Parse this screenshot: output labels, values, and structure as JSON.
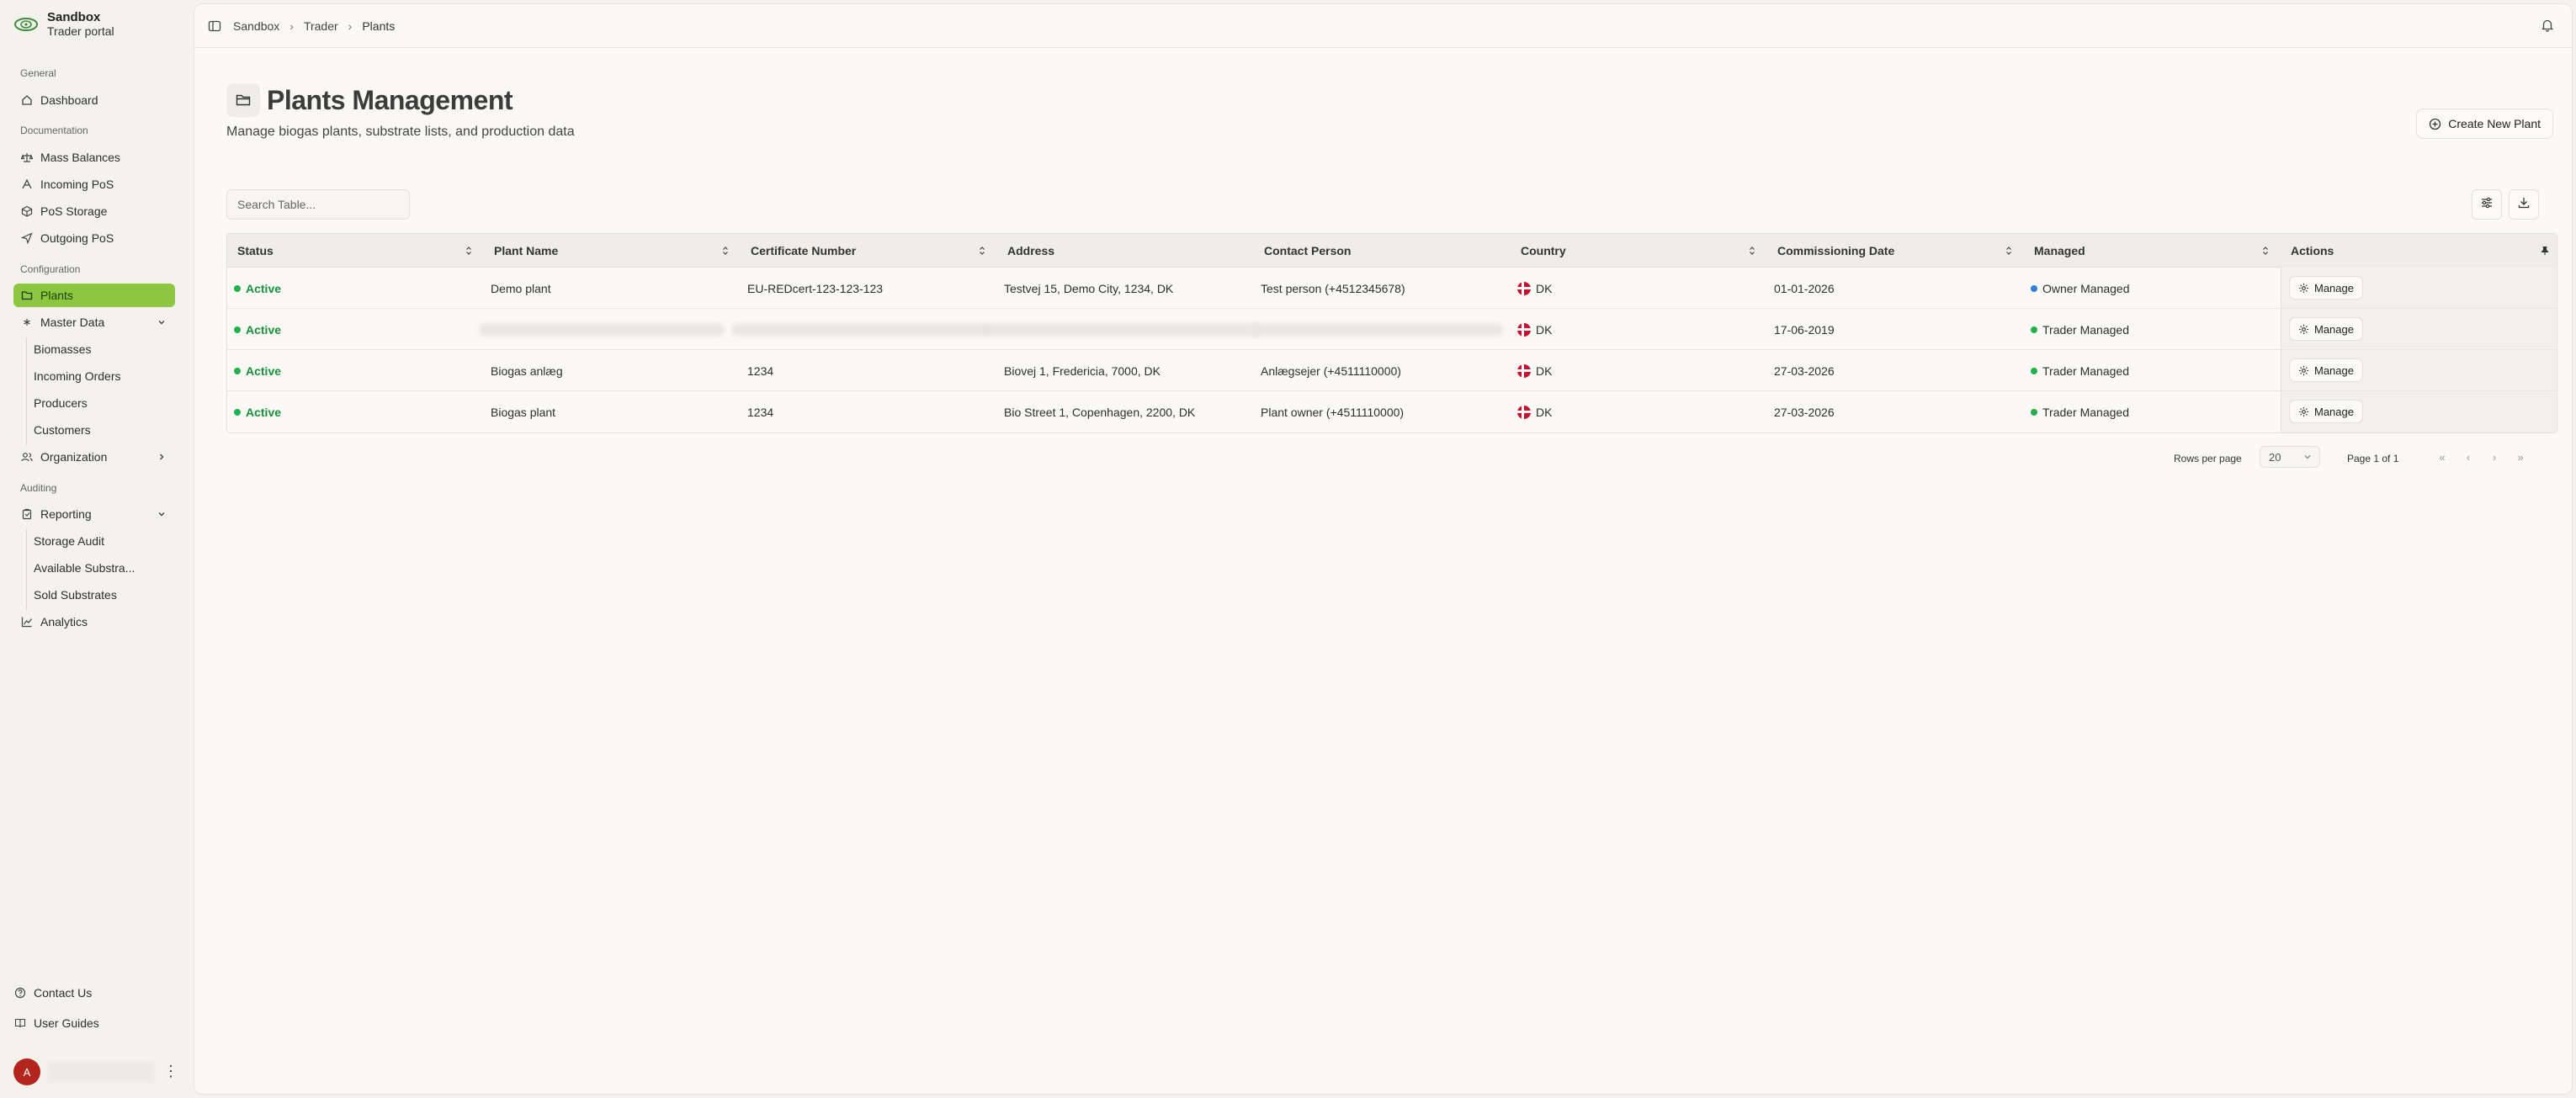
{
  "brand": {
    "title": "Sandbox",
    "subtitle": "Trader portal"
  },
  "sidebar": {
    "sections": {
      "general": "General",
      "documentation": "Documentation",
      "configuration": "Configuration",
      "auditing": "Auditing"
    },
    "dashboard": "Dashboard",
    "mass_balances": "Mass Balances",
    "incoming_pos": "Incoming PoS",
    "pos_storage": "PoS Storage",
    "outgoing_pos": "Outgoing PoS",
    "plants": "Plants",
    "master_data": "Master Data",
    "master_children": [
      "Biomasses",
      "Incoming Orders",
      "Producers",
      "Customers"
    ],
    "organization": "Organization",
    "reporting": "Reporting",
    "reporting_children": [
      "Storage Audit",
      "Available Substra...",
      "Sold Substrates"
    ],
    "analytics": "Analytics",
    "contact_us": "Contact Us",
    "user_guides": "User Guides",
    "avatar_initial": "A"
  },
  "breadcrumb": [
    "Sandbox",
    "Trader",
    "Plants"
  ],
  "page": {
    "title": "Plants Management",
    "subtitle": "Manage biogas plants, substrate lists, and production data",
    "create_button": "Create New Plant"
  },
  "search": {
    "placeholder": "Search Table..."
  },
  "table": {
    "columns": [
      "Status",
      "Plant Name",
      "Certificate Number",
      "Address",
      "Contact Person",
      "Country",
      "Commissioning Date",
      "Managed",
      "Actions"
    ],
    "rows": [
      {
        "status": "Active",
        "name": "Demo plant",
        "cert": "EU-REDcert-123-123-123",
        "address": "Testvej 15, Demo City, 1234, DK",
        "contact": "Test person (+4512345678)",
        "country": "DK",
        "date": "01-01-2026",
        "managed": "Owner Managed",
        "managed_color": "#2f7fdc",
        "action": "Manage"
      },
      {
        "status": "Active",
        "name": "",
        "cert": "",
        "address": "",
        "contact": "",
        "country": "DK",
        "date": "17-06-2019",
        "managed": "Trader Managed",
        "managed_color": "#22b04b",
        "action": "Manage"
      },
      {
        "status": "Active",
        "name": "Biogas anlæg",
        "cert": "1234",
        "address": "Biovej 1, Fredericia, 7000, DK",
        "contact": "Anlægsejer (+4511110000)",
        "country": "DK",
        "date": "27-03-2026",
        "managed": "Trader Managed",
        "managed_color": "#22b04b",
        "action": "Manage"
      },
      {
        "status": "Active",
        "name": "Biogas plant",
        "cert": "1234",
        "address": "Bio Street 1, Copenhagen, 2200, DK",
        "contact": "Plant owner (+4511110000)",
        "country": "DK",
        "date": "27-03-2026",
        "managed": "Trader Managed",
        "managed_color": "#22b04b",
        "action": "Manage"
      }
    ]
  },
  "pagination": {
    "rows_label": "Rows per page",
    "rows_value": "20",
    "page_label": "Page 1 of 1"
  },
  "colors": {
    "accent": "#8dc63f",
    "active_status": "#1a8f3c",
    "avatar": "#b3261e"
  }
}
